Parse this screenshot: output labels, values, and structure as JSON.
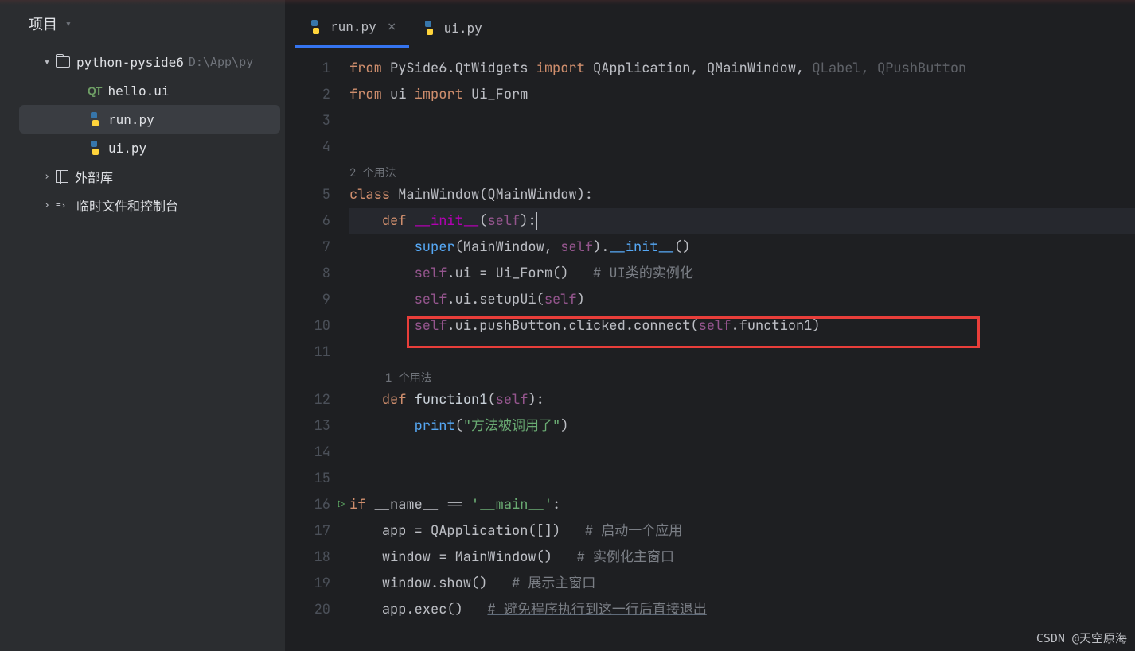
{
  "sidebar": {
    "title": "项目",
    "project_name": "python-pyside6",
    "project_path": "D:\\App\\py",
    "files": [
      {
        "name": "hello.ui",
        "icon": "qt"
      },
      {
        "name": "run.py",
        "icon": "py",
        "selected": true
      },
      {
        "name": "ui.py",
        "icon": "py"
      }
    ],
    "external_libs": "外部库",
    "temp_console": "临时文件和控制台"
  },
  "tabs": [
    {
      "name": "run.py",
      "active": true
    },
    {
      "name": "ui.py",
      "active": false
    }
  ],
  "usage_hints": {
    "class": "2 个用法",
    "function": "1 个用法"
  },
  "code": {
    "line1": {
      "from": "from",
      "mod": "PySide6.QtWidgets",
      "import": "import",
      "items": "QApplication, QMainWindow,",
      "dim_items": " QLabel, QPushButton"
    },
    "line2": {
      "from": "from",
      "mod": "ui",
      "import": "import",
      "items": "Ui_Form"
    },
    "line5": {
      "class": "class",
      "name": "MainWindow",
      "paren_open": "(",
      "base": "QMainWindow",
      "paren_close": "):"
    },
    "line6": {
      "def": "def",
      "name": "__init__",
      "args_open": "(",
      "self": "self",
      "args_close": "):"
    },
    "line7": {
      "super": "super",
      "paren": "(MainWindow, ",
      "self": "self",
      "close": ").",
      "init": "__init__",
      "end": "()"
    },
    "line8": {
      "self": "self",
      "text": ".ui = Ui_Form()   ",
      "cmt": "# UI类的实例化"
    },
    "line9": {
      "self1": "self",
      "text1": ".ui.setupUi(",
      "self2": "self",
      "text2": ")"
    },
    "line10": {
      "self1": "self",
      "text1": ".ui.pushButton.clicked.connect(",
      "self2": "self",
      "text2": ".function1)"
    },
    "line12": {
      "def": "def",
      "name": "function1",
      "args_open": "(",
      "self": "self",
      "args_close": "):"
    },
    "line13": {
      "print": "print",
      "open": "(",
      "str": "\"方法被调用了\"",
      "close": ")"
    },
    "line16": {
      "if": "if",
      "name": "__name__",
      "eq": " == ",
      "str": "'__main__'",
      "colon": ":"
    },
    "line17": {
      "text": "app = QApplication([])   ",
      "cmt": "# 启动一个应用"
    },
    "line18": {
      "text": "window = MainWindow()   ",
      "cmt": "# 实例化主窗口"
    },
    "line19": {
      "text": "window.show()   ",
      "cmt": "# 展示主窗口"
    },
    "line20": {
      "text": "app.exec()   ",
      "cmt": "# 避免程序执行到这一行后直接退出"
    }
  },
  "watermark": "CSDN @天空原海"
}
